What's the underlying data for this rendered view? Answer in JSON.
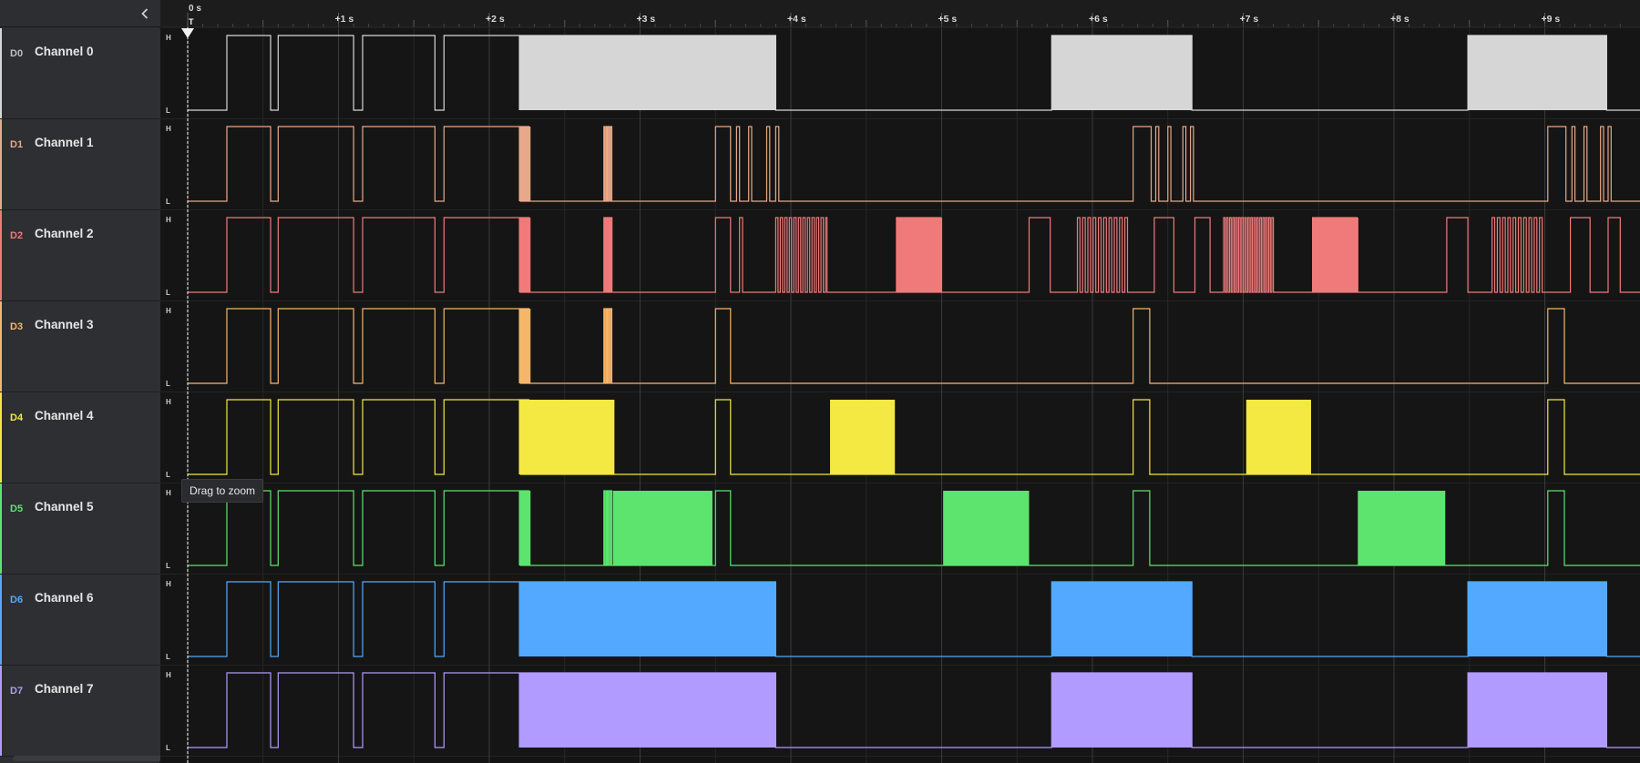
{
  "sidebar": {
    "collapse_icon": "chevron-left-icon",
    "channels": [
      {
        "id": "D0",
        "name": "Channel 0",
        "color": "#d6d6d6",
        "id_color": "#bfbfbf"
      },
      {
        "id": "D1",
        "name": "Channel 1",
        "color": "#e8a98a",
        "id_color": "#e8a98a"
      },
      {
        "id": "D2",
        "name": "Channel 2",
        "color": "#f07a7a",
        "id_color": "#f07a7a"
      },
      {
        "id": "D3",
        "name": "Channel 3",
        "color": "#f5b66a",
        "id_color": "#f5b66a"
      },
      {
        "id": "D4",
        "name": "Channel 4",
        "color": "#f4e843",
        "id_color": "#f4e843"
      },
      {
        "id": "D5",
        "name": "Channel 5",
        "color": "#5ce46e",
        "id_color": "#5ce46e"
      },
      {
        "id": "D6",
        "name": "Channel 6",
        "color": "#53a9ff",
        "id_color": "#53a9ff"
      },
      {
        "id": "D7",
        "name": "Channel 7",
        "color": "#b19bff",
        "id_color": "#b19bff"
      }
    ]
  },
  "timeline": {
    "origin_label": "0 s",
    "trigger_label": "T",
    "ticks": [
      "+1 s",
      "+2 s",
      "+3 s",
      "+4 s",
      "+5 s",
      "+6 s",
      "+7 s",
      "+8 s",
      "+9 s"
    ]
  },
  "levels": {
    "high": "H",
    "low": "L"
  },
  "tooltip": "Drag to zoom"
}
